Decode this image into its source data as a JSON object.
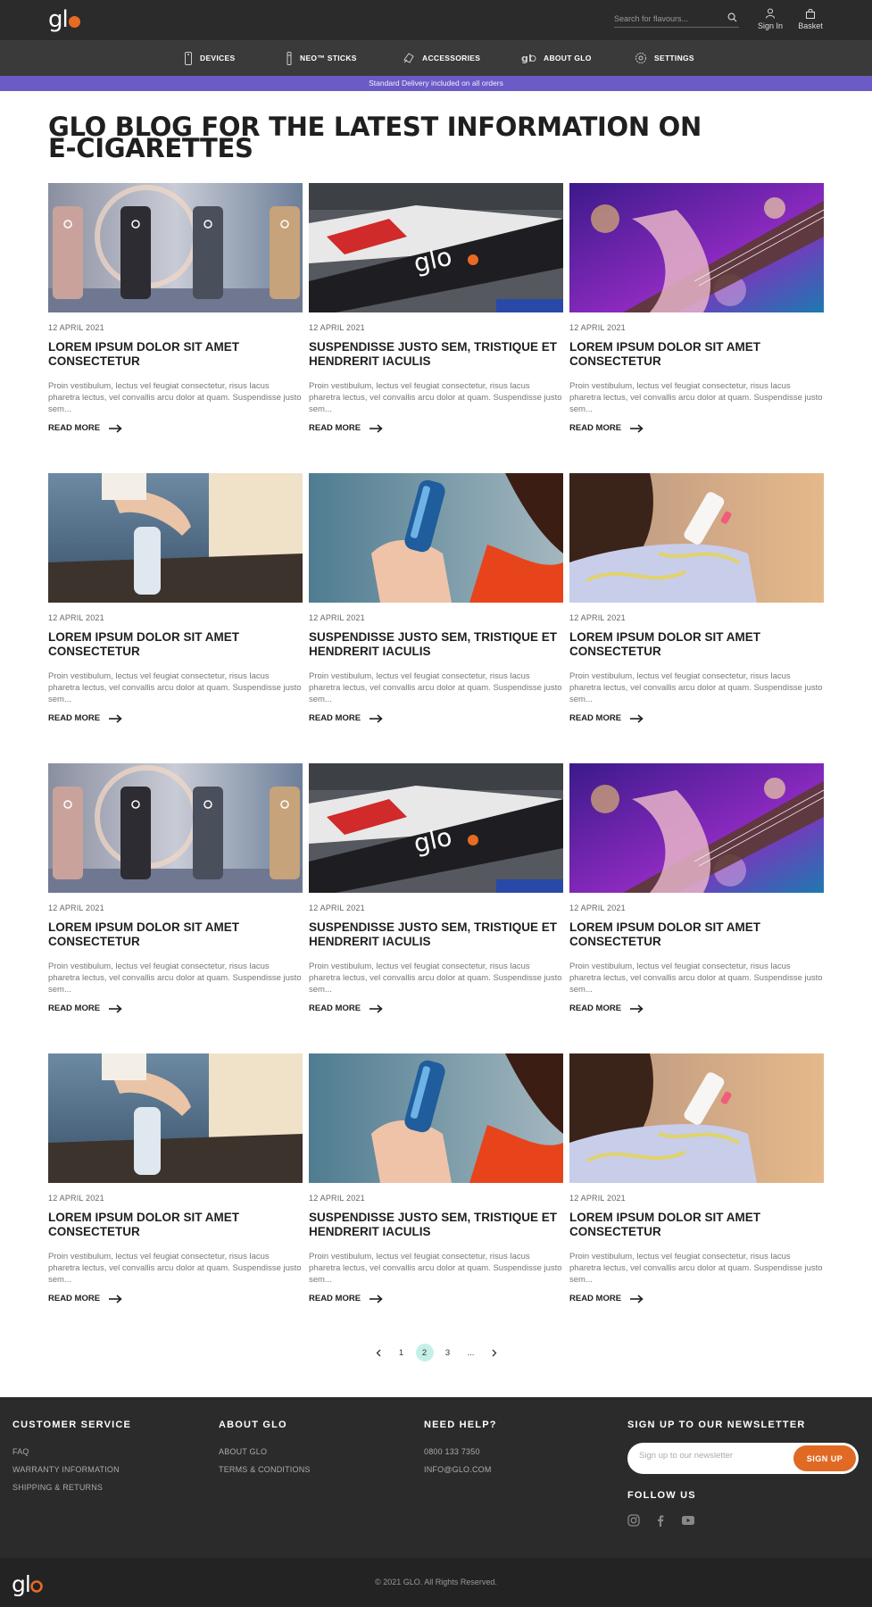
{
  "header": {
    "logo_text": "gl",
    "search_placeholder": "Search for flavours...",
    "sign_in_label": "Sign In",
    "basket_label": "Basket"
  },
  "nav": {
    "items": [
      {
        "label": "DEVICES",
        "icon": "device-icon"
      },
      {
        "label": "NEO™ STICKS",
        "icon": "stick-icon"
      },
      {
        "label": "ACCESSORIES",
        "icon": "accessories-icon"
      },
      {
        "label": "ABOUT GLO",
        "icon": "glo-icon"
      },
      {
        "label": "SETTINGS",
        "icon": "gear-icon"
      }
    ]
  },
  "promo_text": "Standard Delivery included on all orders",
  "page_title": "GLO BLOG FOR THE LATEST INFORMATION ON E-CIGARETTES",
  "posts": [
    {
      "date": "12 APRIL 2021",
      "title": "LOREM IPSUM DOLOR SIT AMET CONSECTETUR",
      "excerpt": "Proin vestibulum, lectus vel feugiat consectetur, risus lacus pharetra lectus, vel convallis arcu dolor at quam. Suspendisse justo sem...",
      "read_more": "READ MORE",
      "image": "devices"
    },
    {
      "date": "12 APRIL 2021",
      "title": "SUSPENDISSE JUSTO SEM, TRISTIQUE ET HENDRERIT IACULIS",
      "excerpt": "Proin vestibulum, lectus vel feugiat consectetur, risus lacus pharetra lectus, vel convallis arcu dolor at quam. Suspendisse justo sem...",
      "read_more": "READ MORE",
      "image": "racecar"
    },
    {
      "date": "12 APRIL 2021",
      "title": "LOREM IPSUM DOLOR SIT AMET CONSECTETUR",
      "excerpt": "Proin vestibulum, lectus vel feugiat consectetur, risus lacus pharetra lectus, vel convallis arcu dolor at quam. Suspendisse justo sem...",
      "read_more": "READ MORE",
      "image": "guitar"
    },
    {
      "date": "12 APRIL 2021",
      "title": "LOREM IPSUM DOLOR SIT AMET CONSECTETUR",
      "excerpt": "Proin vestibulum, lectus vel feugiat consectetur, risus lacus pharetra lectus, vel convallis arcu dolor at quam. Suspendisse justo sem...",
      "read_more": "READ MORE",
      "image": "hand-rock"
    },
    {
      "date": "12 APRIL 2021",
      "title": "SUSPENDISSE JUSTO SEM, TRISTIQUE ET HENDRERIT IACULIS",
      "excerpt": "Proin vestibulum, lectus vel feugiat consectetur, risus lacus pharetra lectus, vel convallis arcu dolor at quam. Suspendisse justo sem...",
      "read_more": "READ MORE",
      "image": "blue-device"
    },
    {
      "date": "12 APRIL 2021",
      "title": "LOREM IPSUM DOLOR SIT AMET CONSECTETUR",
      "excerpt": "Proin vestibulum, lectus vel feugiat consectetur, risus lacus pharetra lectus, vel convallis arcu dolor at quam. Suspendisse justo sem...",
      "read_more": "READ MORE",
      "image": "woman-device"
    },
    {
      "date": "12 APRIL 2021",
      "title": "LOREM IPSUM DOLOR SIT AMET CONSECTETUR",
      "excerpt": "Proin vestibulum, lectus vel feugiat consectetur, risus lacus pharetra lectus, vel convallis arcu dolor at quam. Suspendisse justo sem...",
      "read_more": "READ MORE",
      "image": "devices"
    },
    {
      "date": "12 APRIL 2021",
      "title": "SUSPENDISSE JUSTO SEM, TRISTIQUE ET HENDRERIT IACULIS",
      "excerpt": "Proin vestibulum, lectus vel feugiat consectetur, risus lacus pharetra lectus, vel convallis arcu dolor at quam. Suspendisse justo sem...",
      "read_more": "READ MORE",
      "image": "racecar"
    },
    {
      "date": "12 APRIL 2021",
      "title": "LOREM IPSUM DOLOR SIT AMET CONSECTETUR",
      "excerpt": "Proin vestibulum, lectus vel feugiat consectetur, risus lacus pharetra lectus, vel convallis arcu dolor at quam. Suspendisse justo sem...",
      "read_more": "READ MORE",
      "image": "guitar"
    },
    {
      "date": "12 APRIL 2021",
      "title": "LOREM IPSUM DOLOR SIT AMET CONSECTETUR",
      "excerpt": "Proin vestibulum, lectus vel feugiat consectetur, risus lacus pharetra lectus, vel convallis arcu dolor at quam. Suspendisse justo sem...",
      "read_more": "READ MORE",
      "image": "hand-rock"
    },
    {
      "date": "12 APRIL 2021",
      "title": "SUSPENDISSE JUSTO SEM, TRISTIQUE ET HENDRERIT IACULIS",
      "excerpt": "Proin vestibulum, lectus vel feugiat consectetur, risus lacus pharetra lectus, vel convallis arcu dolor at quam. Suspendisse justo sem...",
      "read_more": "READ MORE",
      "image": "blue-device"
    },
    {
      "date": "12 APRIL 2021",
      "title": "LOREM IPSUM DOLOR SIT AMET CONSECTETUR",
      "excerpt": "Proin vestibulum, lectus vel feugiat consectetur, risus lacus pharetra lectus, vel convallis arcu dolor at quam. Suspendisse justo sem...",
      "read_more": "READ MORE",
      "image": "woman-device"
    }
  ],
  "pagination": {
    "pages": [
      "1",
      "2",
      "3",
      "..."
    ],
    "current": "2"
  },
  "footer": {
    "customer_service": {
      "heading": "CUSTOMER SERVICE",
      "links": [
        "FAQ",
        "WARRANTY INFORMATION",
        "SHIPPING & RETURNS"
      ]
    },
    "about": {
      "heading": "ABOUT GLO",
      "links": [
        "ABOUT GLO",
        "TERMS & CONDITIONS"
      ]
    },
    "help": {
      "heading": "NEED HELP?",
      "links": [
        "0800 133 7350",
        "INFO@GLO.COM"
      ]
    },
    "newsletter": {
      "heading": "SIGN UP TO OUR NEWSLETTER",
      "placeholder": "Sign up to our newsletter",
      "button": "SIGN UP"
    },
    "follow_heading": "FOLLOW US",
    "social": [
      "instagram-icon",
      "facebook-icon",
      "youtube-icon"
    ],
    "copyright": "© 2021 GLO. All Rights Reserved."
  },
  "colors": {
    "accent": "#e86a23",
    "promo": "#6b5bc7",
    "page_active": "#c5f0ea",
    "dark": "#2b2b2b"
  }
}
